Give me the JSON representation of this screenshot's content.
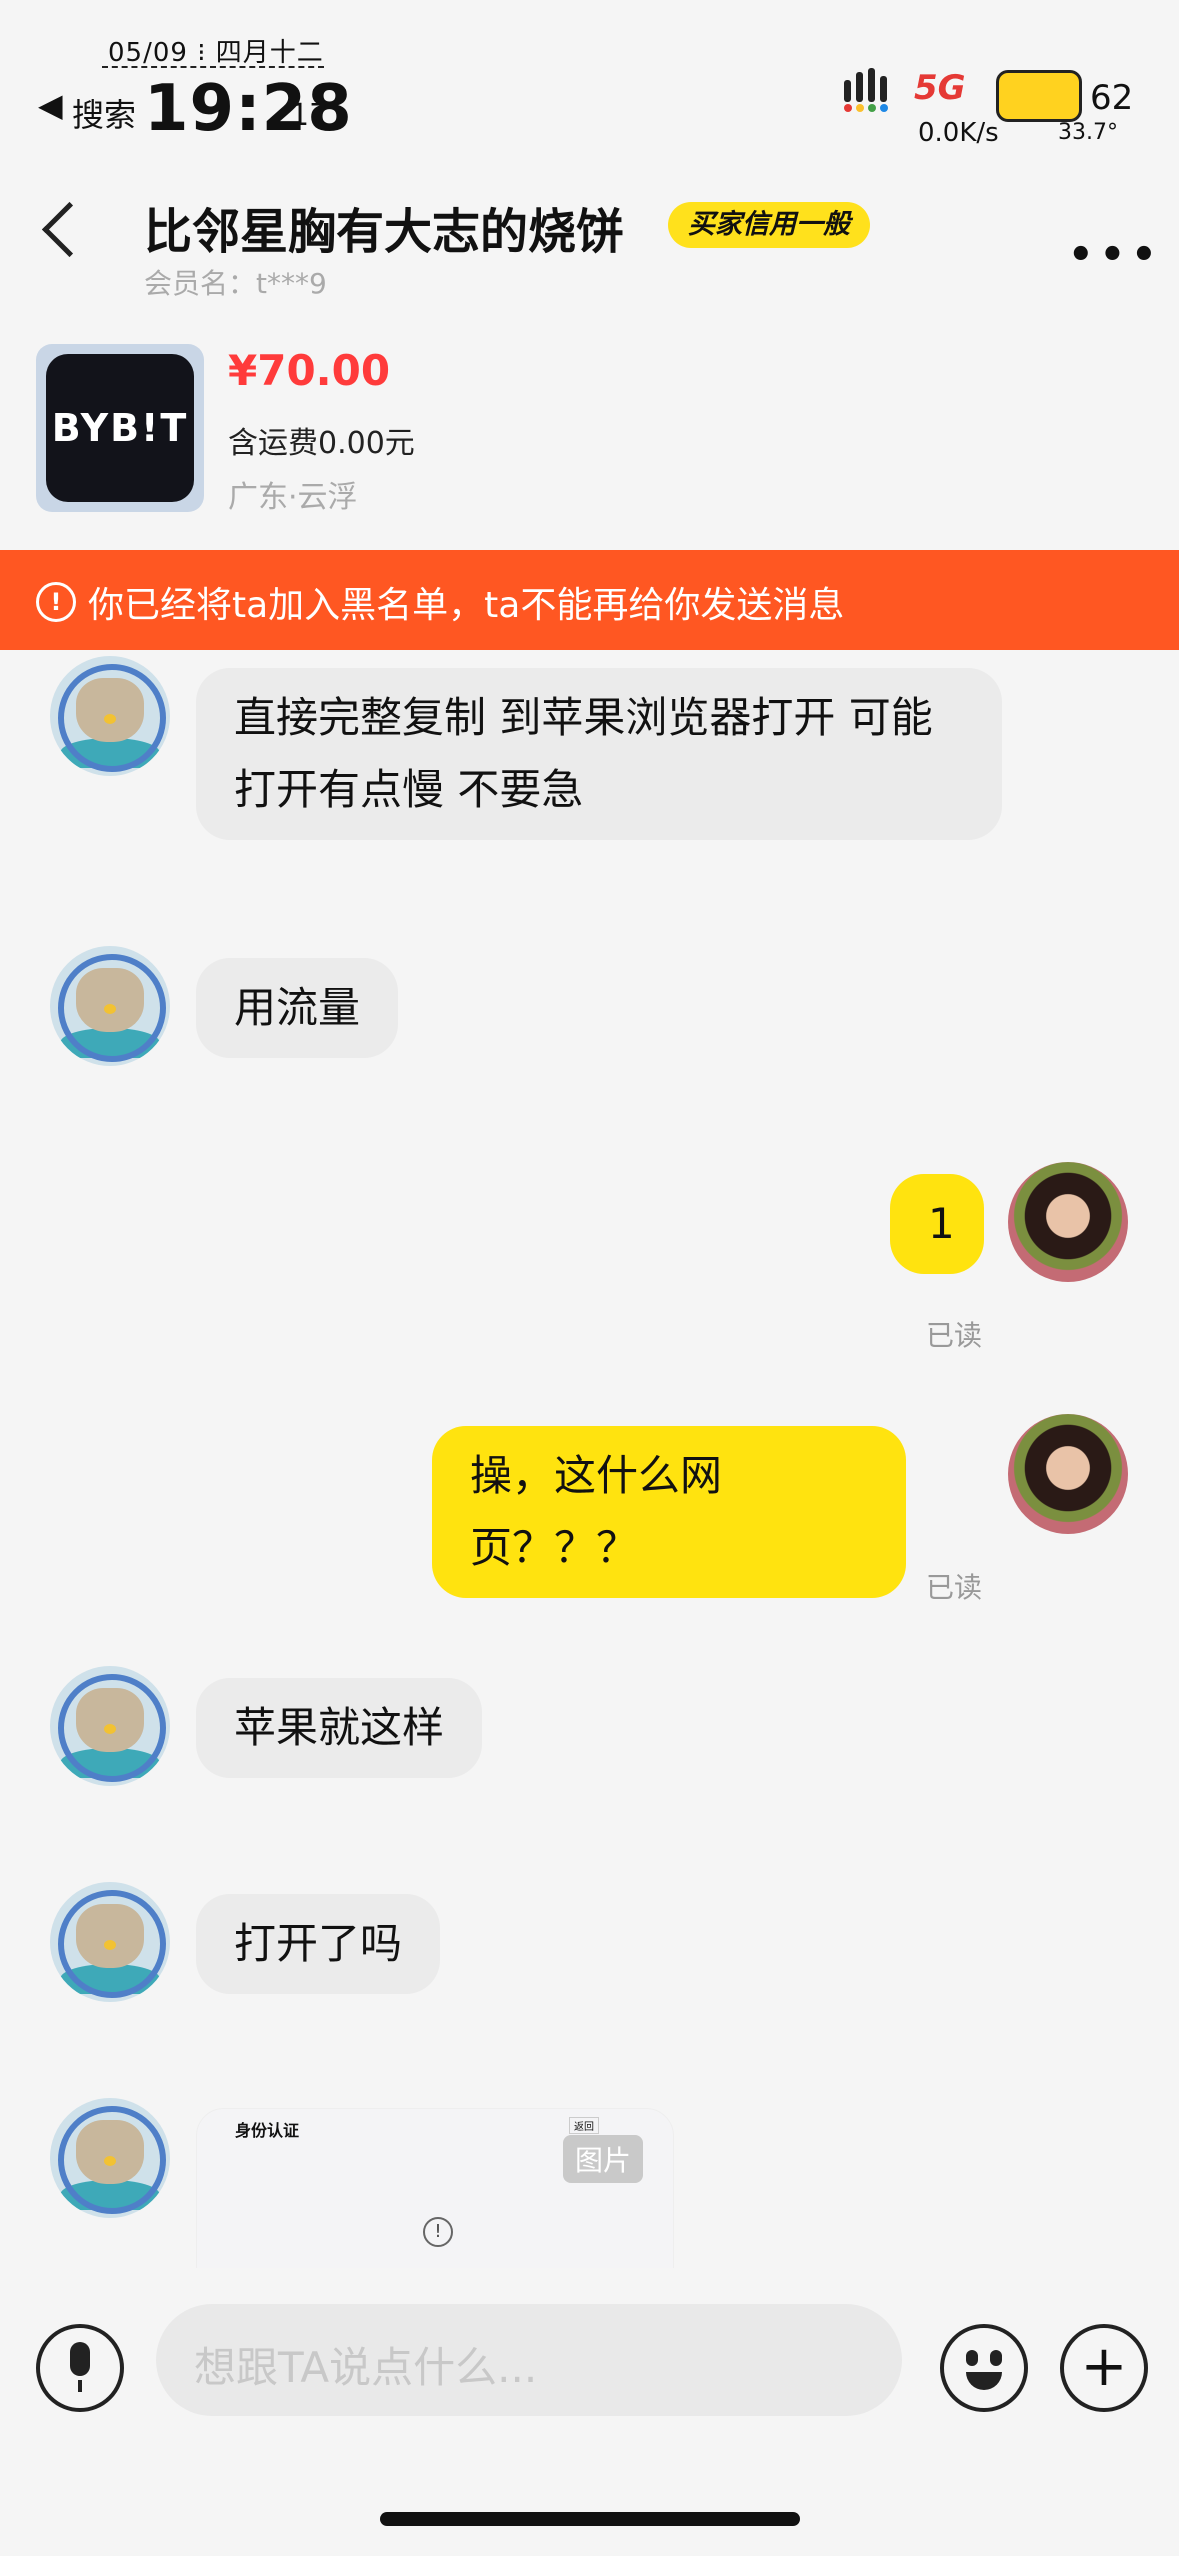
{
  "status_bar": {
    "date": "05/09 ⁝ 四月十二",
    "back_label": "◀",
    "search_label": "搜索",
    "time": "19:28",
    "seconds": "17",
    "network_speed": "0.0K/s",
    "battery": "62",
    "temperature": "33.7°"
  },
  "header": {
    "title": "比邻星胸有大志的烧饼",
    "credit_badge": "买家信用一般",
    "member": "会员名：t***9",
    "more_label": "•••"
  },
  "product": {
    "logo_text": "BYB!T",
    "price": "¥70.00",
    "shipping": "含运费0.00元",
    "location": "广东·云浮"
  },
  "banner": {
    "icon": "!",
    "text": "你已经将ta加入黑名单，ta不能再给你发送消息"
  },
  "messages": [
    {
      "text": "直接完整复制 到苹果浏览器打开  可能打开有点慢 不要急"
    },
    {
      "text": "用流量"
    },
    {
      "text": "1",
      "status": "已读"
    },
    {
      "text": "操，这什么网页？？？",
      "status": "已读"
    },
    {
      "text": "苹果就这样"
    },
    {
      "text": "打开了吗"
    }
  ],
  "image_message": {
    "title": "身份认证",
    "button": "返回",
    "tag": "图片",
    "warn": "!"
  },
  "input": {
    "placeholder": "想跟TA说点什么..."
  },
  "colors": {
    "accent_yellow": "#ffe30f",
    "banner_orange": "#ff5722",
    "price_red": "#ff3b3b"
  }
}
